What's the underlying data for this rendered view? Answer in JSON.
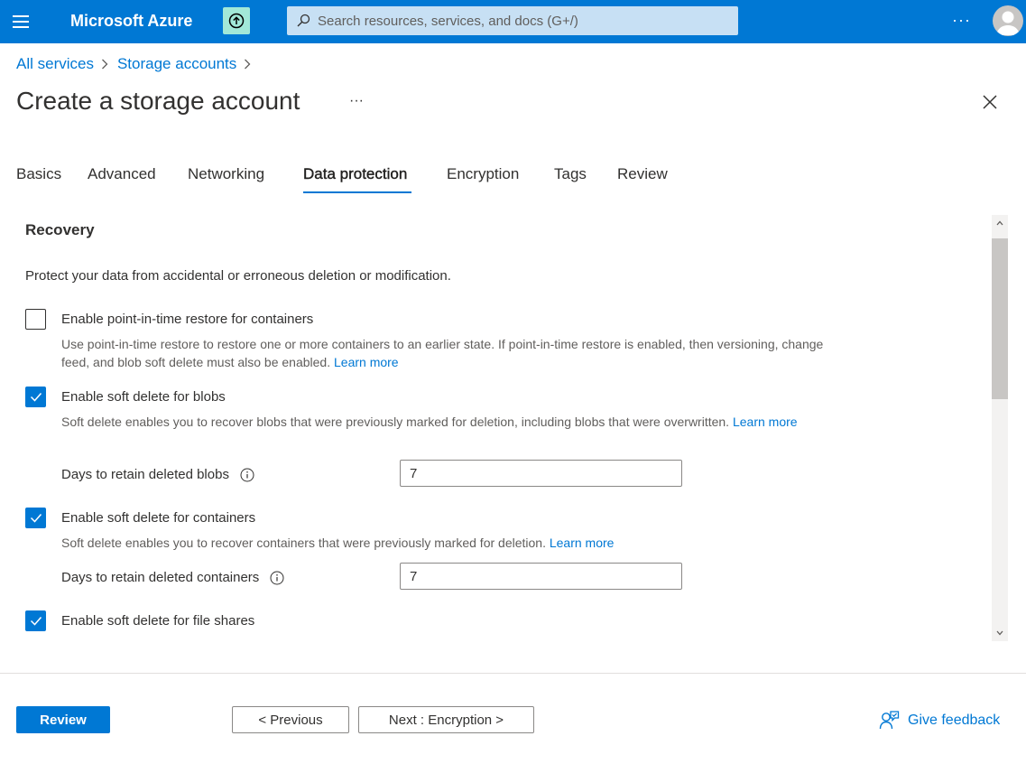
{
  "header": {
    "brand": "Microsoft Azure",
    "search_placeholder": "Search resources, services, and docs (G+/)",
    "more": "···"
  },
  "breadcrumb": {
    "items": [
      "All services",
      "Storage accounts"
    ]
  },
  "page": {
    "title": "Create a storage account",
    "more": "···"
  },
  "tabs": [
    "Basics",
    "Advanced",
    "Networking",
    "Data protection",
    "Encryption",
    "Tags",
    "Review"
  ],
  "active_tab": "Data protection",
  "recovery": {
    "title": "Recovery",
    "description": "Protect your data from accidental or erroneous deletion or modification.",
    "options": [
      {
        "label": "Enable point-in-time restore for containers",
        "checked": false,
        "help": "Use point-in-time restore to restore one or more containers to an earlier state. If point-in-time restore is enabled, then versioning, change feed, and blob soft delete must also be enabled.",
        "link": "Learn more"
      },
      {
        "label": "Enable soft delete for blobs",
        "checked": true,
        "help": "Soft delete enables you to recover blobs that were previously marked for deletion, including blobs that were overwritten.",
        "link": "Learn more",
        "days_label": "Days to retain deleted blobs",
        "days_value": "7"
      },
      {
        "label": "Enable soft delete for containers",
        "checked": true,
        "help": "Soft delete enables you to recover containers that were previously marked for deletion.",
        "link": "Learn more",
        "days_label": "Days to retain deleted containers",
        "days_value": "7"
      },
      {
        "label": "Enable soft delete for file shares",
        "checked": true
      }
    ]
  },
  "footer": {
    "review": "Review",
    "previous": "< Previous",
    "next": "Next : Encryption >",
    "feedback": "Give feedback"
  },
  "colors": {
    "accent": "#0078d4",
    "upload_button": "#a2e8d8",
    "search_bg": "#c7e0f4"
  }
}
